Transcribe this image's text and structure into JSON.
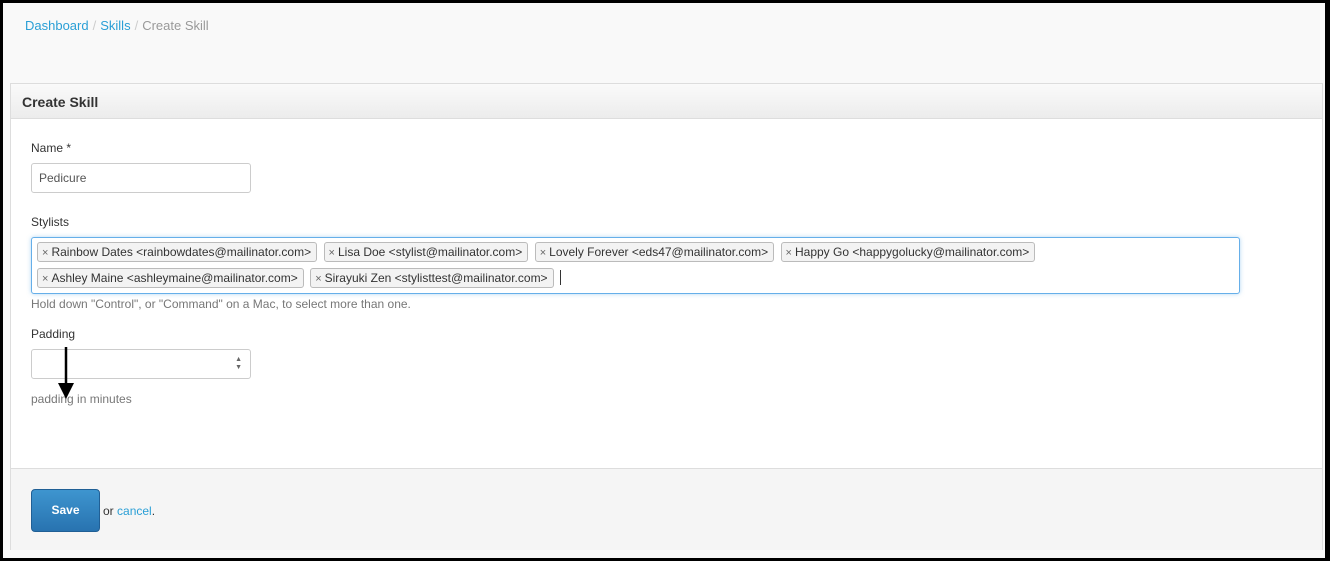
{
  "breadcrumb": {
    "items": [
      "Dashboard",
      "Skills"
    ],
    "current": "Create Skill",
    "separator": "/"
  },
  "panel": {
    "title": "Create Skill"
  },
  "form": {
    "name": {
      "label": "Name *",
      "value": "Pedicure"
    },
    "stylists": {
      "label": "Stylists",
      "selected": [
        "Rainbow Dates <rainbowdates@mailinator.com>",
        "Lisa Doe <stylist@mailinator.com>",
        "Lovely Forever <eds47@mailinator.com>",
        "Happy Go <happygolucky@mailinator.com>",
        "Ashley Maine <ashleymaine@mailinator.com>",
        "Sirayuki Zen <stylisttest@mailinator.com>"
      ],
      "remove_glyph": "×",
      "help": "Hold down \"Control\", or \"Command\" on a Mac, to select more than one."
    },
    "padding": {
      "label": "Padding",
      "value": "",
      "help": "padding in minutes"
    }
  },
  "actions": {
    "save_label": "Save",
    "or_text": "or",
    "cancel_label": "cancel",
    "period": "."
  },
  "colors": {
    "link": "#2a9fd6",
    "save_button": "#2f80bf",
    "focus_border": "#66afe9"
  }
}
